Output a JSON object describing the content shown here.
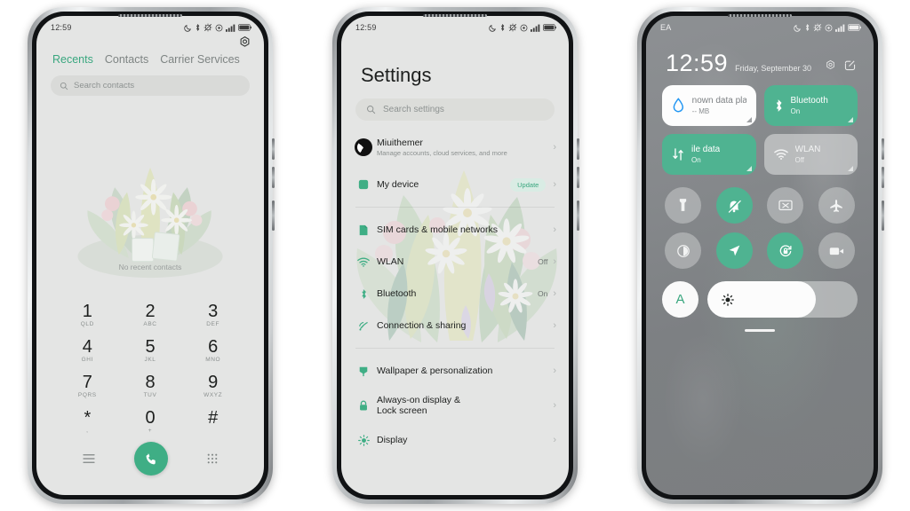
{
  "theme": {
    "accent": "#3fae85",
    "tile_on": "#4fb391",
    "screen_bg": "#e4e5e4",
    "cc_bg": "#85888b"
  },
  "dialer": {
    "status": {
      "time": "12:59",
      "icons": [
        "dnd-moon-icon",
        "bluetooth-icon",
        "vibrate-off-icon",
        "location-icon",
        "signal-bars-icon",
        "battery-icon"
      ]
    },
    "settings_icon": "gear-icon",
    "tabs": [
      {
        "label": "Recents",
        "active": true
      },
      {
        "label": "Contacts",
        "active": false
      },
      {
        "label": "Carrier Services",
        "active": false
      }
    ],
    "search": {
      "placeholder": "Search contacts",
      "icon": "search-icon"
    },
    "empty_state": "No recent contacts",
    "keypad": [
      {
        "num": "1",
        "sub": "QLD"
      },
      {
        "num": "2",
        "sub": "ABC"
      },
      {
        "num": "3",
        "sub": "DEF"
      },
      {
        "num": "4",
        "sub": "GHI"
      },
      {
        "num": "5",
        "sub": "JKL"
      },
      {
        "num": "6",
        "sub": "MNO"
      },
      {
        "num": "7",
        "sub": "PQRS"
      },
      {
        "num": "8",
        "sub": "TUV"
      },
      {
        "num": "9",
        "sub": "WXYZ"
      },
      {
        "num": "*",
        "sub": ","
      },
      {
        "num": "0",
        "sub": "+"
      },
      {
        "num": "#",
        "sub": ""
      }
    ],
    "bottom_bar": {
      "menu_icon": "menu-lines-icon",
      "call_icon": "phone-call-icon",
      "keypad_icon": "dialpad-icon"
    }
  },
  "settings": {
    "status": {
      "time": "12:59"
    },
    "title": "Settings",
    "search": {
      "placeholder": "Search settings",
      "icon": "search-icon"
    },
    "account": {
      "name": "Miuithemer",
      "subtitle": "Manage accounts, cloud services, and more",
      "avatar": "account-avatar"
    },
    "rows_group1": [
      {
        "label": "My device",
        "value": "",
        "badge": "Update",
        "icon": "device-icon"
      }
    ],
    "rows_group2": [
      {
        "label": "SIM cards & mobile networks",
        "value": "",
        "icon": "sim-card-icon"
      },
      {
        "label": "WLAN",
        "value": "Off",
        "icon": "wifi-icon"
      },
      {
        "label": "Bluetooth",
        "value": "On",
        "icon": "bluetooth-icon"
      },
      {
        "label": "Connection & sharing",
        "value": "",
        "icon": "connection-sharing-icon"
      }
    ],
    "rows_group3": [
      {
        "label": "Wallpaper & personalization",
        "value": "",
        "icon": "wallpaper-icon"
      },
      {
        "label": "Always-on display & Lock screen",
        "value": "",
        "icon": "lock-icon"
      },
      {
        "label": "Display",
        "value": "",
        "icon": "brightness-icon"
      }
    ],
    "chevron": "›"
  },
  "control_center": {
    "status": {
      "carrier": "EA",
      "time_hidden": ""
    },
    "clock": "12:59",
    "date": "Friday, September 30",
    "top_icons": [
      "gear-icon",
      "edit-square-icon"
    ],
    "big_tiles": [
      {
        "title": "nown data pla",
        "sub": "-- MB",
        "state": "white",
        "icon": "data-drop-icon"
      },
      {
        "title": "Bluetooth",
        "sub": "On",
        "state": "on",
        "icon": "bluetooth-icon"
      },
      {
        "title": "ile data",
        "sub": "On",
        "state": "on",
        "icon": "mobile-data-icon"
      },
      {
        "title": "WLAN",
        "sub": "Off",
        "state": "off",
        "icon": "wifi-icon"
      }
    ],
    "circle_toggles": [
      {
        "name": "flashlight-icon",
        "state": "off"
      },
      {
        "name": "silent-mode-icon",
        "state": "on"
      },
      {
        "name": "cast-screen-icon",
        "state": "off"
      },
      {
        "name": "airplane-mode-icon",
        "state": "off"
      },
      {
        "name": "dark-mode-icon",
        "state": "off"
      },
      {
        "name": "location-icon",
        "state": "on"
      },
      {
        "name": "auto-rotate-icon",
        "state": "on"
      },
      {
        "name": "screen-recorder-icon",
        "state": "off"
      }
    ],
    "brightness": {
      "auto_label": "A",
      "level_percent": 72,
      "icon": "sun-icon"
    }
  }
}
